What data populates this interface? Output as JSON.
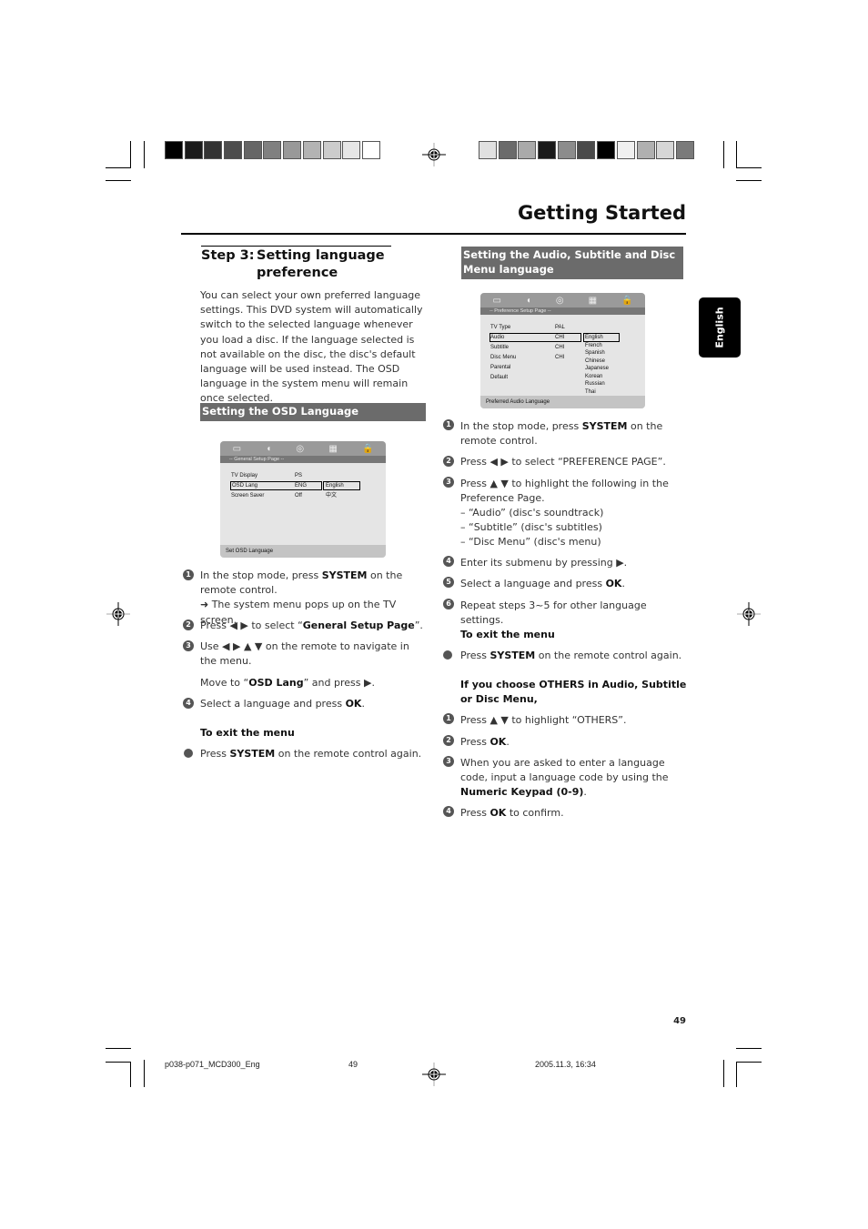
{
  "header": {
    "title": "Getting Started",
    "left_swatches": [
      "#000000",
      "#1a1a1a",
      "#333333",
      "#4d4d4d",
      "#666666",
      "#808080",
      "#999999",
      "#b3b3b3",
      "#cccccc",
      "#e6e6e6",
      "#ffffff"
    ],
    "right_swatches": [
      "#e0e0e0",
      "#6b6b6b",
      "#aaaaaa",
      "#1a1a1a",
      "#8c8c8c",
      "#4a4a4a",
      "#000000",
      "#f0f0f0",
      "#b0b0b0",
      "#d6d6d6",
      "#7a7a7a"
    ]
  },
  "side_tab": {
    "label": "English"
  },
  "left": {
    "step_label": "Step 3:",
    "step_title": "Setting language preference",
    "intro": "You can select your own preferred language settings. This DVD system will automatically switch to the selected language whenever you load a disc. If the language selected is not available on the disc, the disc's default language will be used instead. The OSD language in the system menu will remain once selected.",
    "section": "Setting the OSD Language",
    "osd": {
      "page": "-- General Setup Page --",
      "rows": [
        {
          "label": "TV Display",
          "value": "PS",
          "option": ""
        },
        {
          "label": "OSD Lang",
          "value": "ENG",
          "option": "English"
        },
        {
          "label": "Screen Saver",
          "value": "Off",
          "option": "中文"
        }
      ],
      "status": "Set OSD Language"
    },
    "steps": [
      {
        "n": "1",
        "pre": "In the stop mode, press ",
        "bold": "SYSTEM",
        "post": " on the remote control.",
        "note": "➜ The system menu pops up on the TV screen."
      },
      {
        "n": "2",
        "pre": "Press ◀ ▶ to select “",
        "bold": "General Setup Page",
        "post": "”."
      },
      {
        "n": "3",
        "pre": "Use ◀ ▶ ▲ ▼ on the remote to navigate in the menu.",
        "bold": "",
        "post": ""
      },
      {
        "n": "",
        "pre": "Move to “",
        "bold": "OSD Lang",
        "post": "” and press ▶."
      },
      {
        "n": "4",
        "pre": "Select a language and press ",
        "bold": "OK",
        "post": "."
      }
    ],
    "exit_title": "To exit the menu",
    "exit": {
      "pre": "Press ",
      "bold": "SYSTEM",
      "post": " on the remote control again."
    }
  },
  "right": {
    "section": "Setting the Audio, Subtitle and Disc Menu language",
    "osd": {
      "page": "-- Preference Setup Page --",
      "rows": [
        {
          "label": "TV Type",
          "value": "PAL"
        },
        {
          "label": "Audio",
          "value": "CHI"
        },
        {
          "label": "Subtitle",
          "value": "CHI"
        },
        {
          "label": "Disc Menu",
          "value": "CHI"
        },
        {
          "label": "Parental",
          "value": ""
        },
        {
          "label": "Default",
          "value": ""
        }
      ],
      "options": [
        "English",
        "French",
        "Spanish",
        "Chinese",
        "Japanese",
        "Korean",
        "Russian",
        "Thai"
      ],
      "status": "Preferred Audio Language"
    },
    "steps": [
      {
        "n": "1",
        "pre": "In the stop mode, press ",
        "bold": "SYSTEM",
        "post": " on the remote control."
      },
      {
        "n": "2",
        "pre": "Press ◀ ▶ to select “PREFERENCE PAGE”.",
        "bold": "",
        "post": ""
      },
      {
        "n": "3",
        "pre": "Press ▲ ▼ to highlight the following in the Preference Page.",
        "bold": "",
        "post": ""
      },
      {
        "n": "4",
        "pre": "Enter its submenu by pressing ▶.",
        "bold": "",
        "post": ""
      },
      {
        "n": "5",
        "pre": "Select a language and press ",
        "bold": "OK",
        "post": "."
      },
      {
        "n": "6",
        "pre": "Repeat steps 3~5 for other language settings.",
        "bold": "",
        "post": ""
      }
    ],
    "step3_items": [
      "–  “Audio” (disc's soundtrack)",
      "–  “Subtitle” (disc's subtitles)",
      "–  “Disc Menu” (disc's menu)"
    ],
    "exit_title": "To exit the menu",
    "exit": {
      "pre": "Press ",
      "bold": "SYSTEM",
      "post": " on the remote control again."
    },
    "others_title": "If you choose OTHERS in Audio, Subtitle or Disc Menu,",
    "others_steps": [
      {
        "n": "1",
        "pre": "Press ▲ ▼ to highlight “OTHERS”.",
        "bold": "",
        "post": ""
      },
      {
        "n": "2",
        "pre": "Press ",
        "bold": "OK",
        "post": "."
      },
      {
        "n": "3",
        "pre": "When you are asked to enter a language code, input a language code by using the ",
        "bold": "Numeric Keypad (0-9)",
        "post": "."
      },
      {
        "n": "4",
        "pre": "Press ",
        "bold": "OK",
        "post": " to confirm."
      }
    ]
  },
  "footer": {
    "page_number": "49",
    "file": "p038-p071_MCD300_Eng",
    "sheet": "49",
    "date": "2005.11.3, 16:34"
  }
}
